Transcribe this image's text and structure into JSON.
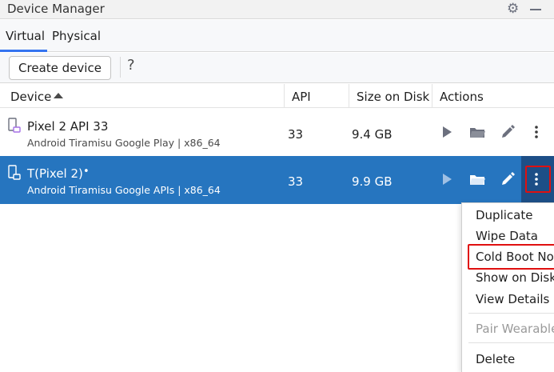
{
  "window": {
    "title": "Device Manager"
  },
  "tabs": [
    {
      "label": "Virtual",
      "active": true
    },
    {
      "label": "Physical",
      "active": false
    }
  ],
  "toolbar": {
    "create_label": "Create device",
    "help_label": "?"
  },
  "table": {
    "columns": [
      "Device",
      "API",
      "Size on Disk",
      "Actions"
    ],
    "rows": [
      {
        "name": "Pixel 2 API 33",
        "subtitle": "Android Tiramisu Google Play | x86_64",
        "api": "33",
        "size": "9.4 GB",
        "selected": false,
        "online": false
      },
      {
        "name": "T(Pixel 2)",
        "subtitle": "Android Tiramisu Google APIs | x86_64",
        "api": "33",
        "size": "9.9 GB",
        "selected": true,
        "online": true,
        "online_marker": "•"
      }
    ]
  },
  "menu": {
    "items": [
      {
        "label": "Duplicate"
      },
      {
        "label": "Wipe Data"
      },
      {
        "label": "Cold Boot Now"
      },
      {
        "label": "Show on Disk"
      },
      {
        "label": "View Details"
      },
      {
        "label": "Pair Wearable"
      },
      {
        "label": "Delete"
      }
    ]
  },
  "colors": {
    "accent": "#3574f0",
    "selection": "#2675bf",
    "highlight": "#e01010"
  }
}
